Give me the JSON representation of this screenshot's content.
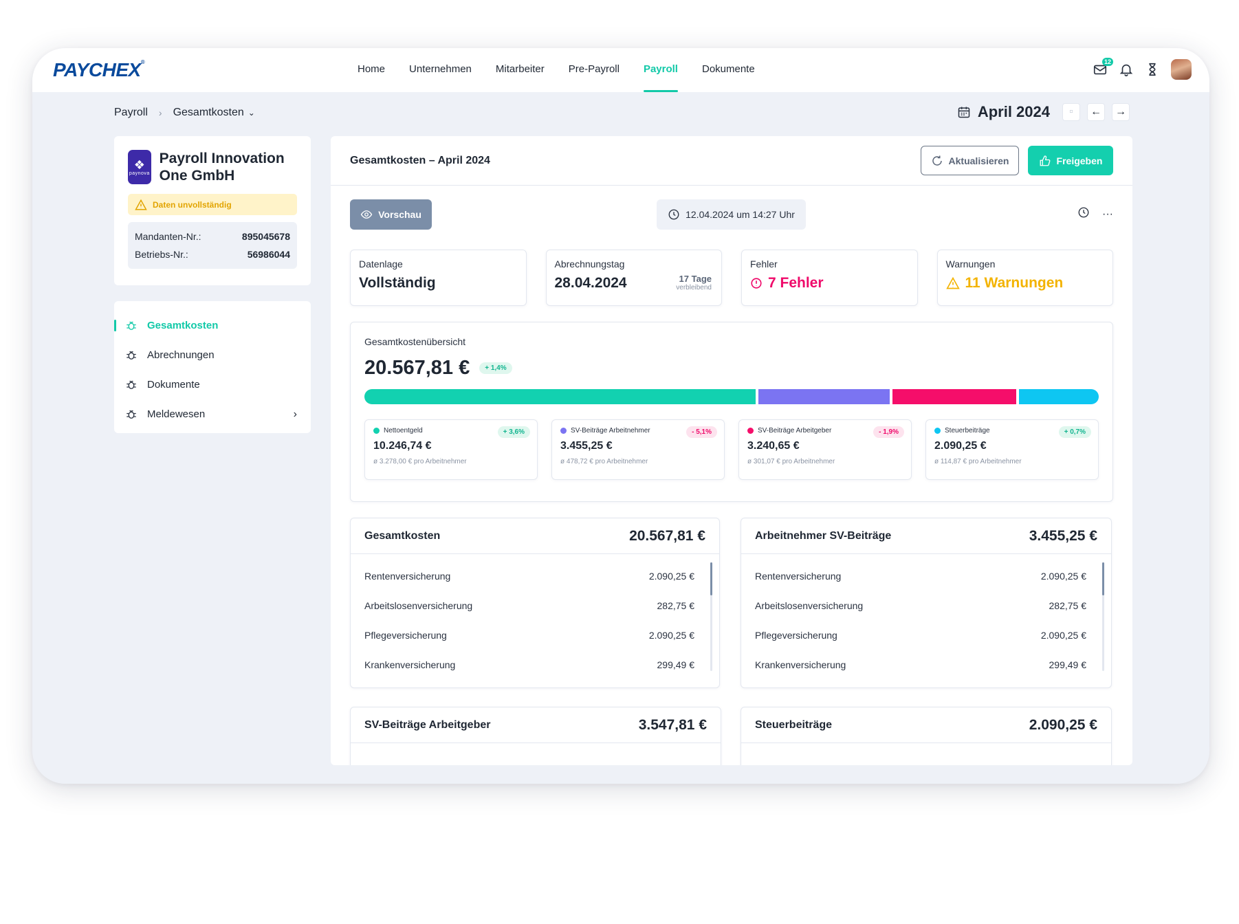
{
  "brand": {
    "logo": "PAYCHEX",
    "accent": "#12c9a8"
  },
  "nav": {
    "items": [
      {
        "label": "Home"
      },
      {
        "label": "Unternehmen"
      },
      {
        "label": "Mitarbeiter"
      },
      {
        "label": "Pre-Payroll"
      },
      {
        "label": "Payroll",
        "active": true
      },
      {
        "label": "Dokumente"
      }
    ],
    "mail_badge": "12"
  },
  "breadcrumb": {
    "root": "Payroll",
    "current": "Gesamtkosten"
  },
  "period": {
    "label": "April 2024"
  },
  "company": {
    "logo_text": "paynova",
    "name": "Payroll Innovation One GmbH",
    "status": "Daten unvollständig",
    "client_label": "Mandanten-Nr.:",
    "client_value": "895045678",
    "company_label": "Betriebs-Nr.:",
    "company_value": "56986044"
  },
  "sidebar": {
    "items": [
      {
        "label": "Gesamtkosten",
        "active": true
      },
      {
        "label": "Abrechnungen"
      },
      {
        "label": "Dokumente"
      },
      {
        "label": "Meldewesen",
        "has_children": true
      }
    ]
  },
  "main": {
    "title": "Gesamtkosten – April 2024",
    "refresh_label": "Aktualisieren",
    "release_label": "Freigeben",
    "preview_label": "Vorschau",
    "timestamp": "12.04.2024 um 14:27 Uhr"
  },
  "kpis": {
    "data": {
      "label": "Datenlage",
      "value": "Vollständig"
    },
    "billing": {
      "label": "Abrechnungstag",
      "value": "28.04.2024",
      "days": "17 Tage",
      "remaining": "verbleibend"
    },
    "errors": {
      "label": "Fehler",
      "value": "7 Fehler",
      "color": "#ef0a6a"
    },
    "warnings": {
      "label": "Warnungen",
      "value": "11 Warnungen",
      "color": "#f3b300"
    }
  },
  "overview": {
    "title": "Gesamtkostenübersicht",
    "total": "20.567,81 €",
    "change": "+ 1,4%",
    "categories": [
      {
        "name": "Nettoentgeld",
        "value": "10.246,74 €",
        "change": "+ 3,6%",
        "trend": "up",
        "avg": "ø 3.278,00 € pro Arbeitnehmer",
        "color": "#12d1b0",
        "share": 10246.74
      },
      {
        "name": "SV-Beiträge Arbeitnehmer",
        "value": "3.455,25 €",
        "change": "- 5,1%",
        "trend": "down",
        "avg": "ø 478,72 € pro Arbeitnehmer",
        "color": "#7b74f2",
        "share": 3455.25
      },
      {
        "name": "SV-Beiträge Arbeitgeber",
        "value": "3.240,65 €",
        "change": "- 1,9%",
        "trend": "down",
        "avg": "ø 301,07 € pro Arbeitnehmer",
        "color": "#f50e6a",
        "share": 3240.65
      },
      {
        "name": "Steuerbeiträge",
        "value": "2.090,25 €",
        "change": "+ 0,7%",
        "trend": "up",
        "avg": "ø 114,87 € pro Arbeitnehmer",
        "color": "#0ec6f2",
        "share": 2090.25
      }
    ]
  },
  "panels": {
    "total": {
      "title": "Gesamtkosten",
      "total": "20.567,81 €",
      "rows": [
        {
          "label": "Rentenversicherung",
          "value": "2.090,25 €"
        },
        {
          "label": "Arbeitslosenversicherung",
          "value": "282,75 €"
        },
        {
          "label": "Pflegeversicherung",
          "value": "2.090,25 €"
        },
        {
          "label": "Krankenversicherung",
          "value": "299,49 €"
        }
      ]
    },
    "employee": {
      "title": "Arbeitnehmer SV-Beiträge",
      "total": "3.455,25 €",
      "rows": [
        {
          "label": "Rentenversicherung",
          "value": "2.090,25 €"
        },
        {
          "label": "Arbeitslosenversicherung",
          "value": "282,75 €"
        },
        {
          "label": "Pflegeversicherung",
          "value": "2.090,25 €"
        },
        {
          "label": "Krankenversicherung",
          "value": "299,49 €"
        }
      ]
    },
    "employer": {
      "title": "SV-Beiträge Arbeitgeber",
      "total": "3.547,81 €"
    },
    "tax": {
      "title": "Steuerbeiträge",
      "total": "2.090,25 €"
    }
  }
}
